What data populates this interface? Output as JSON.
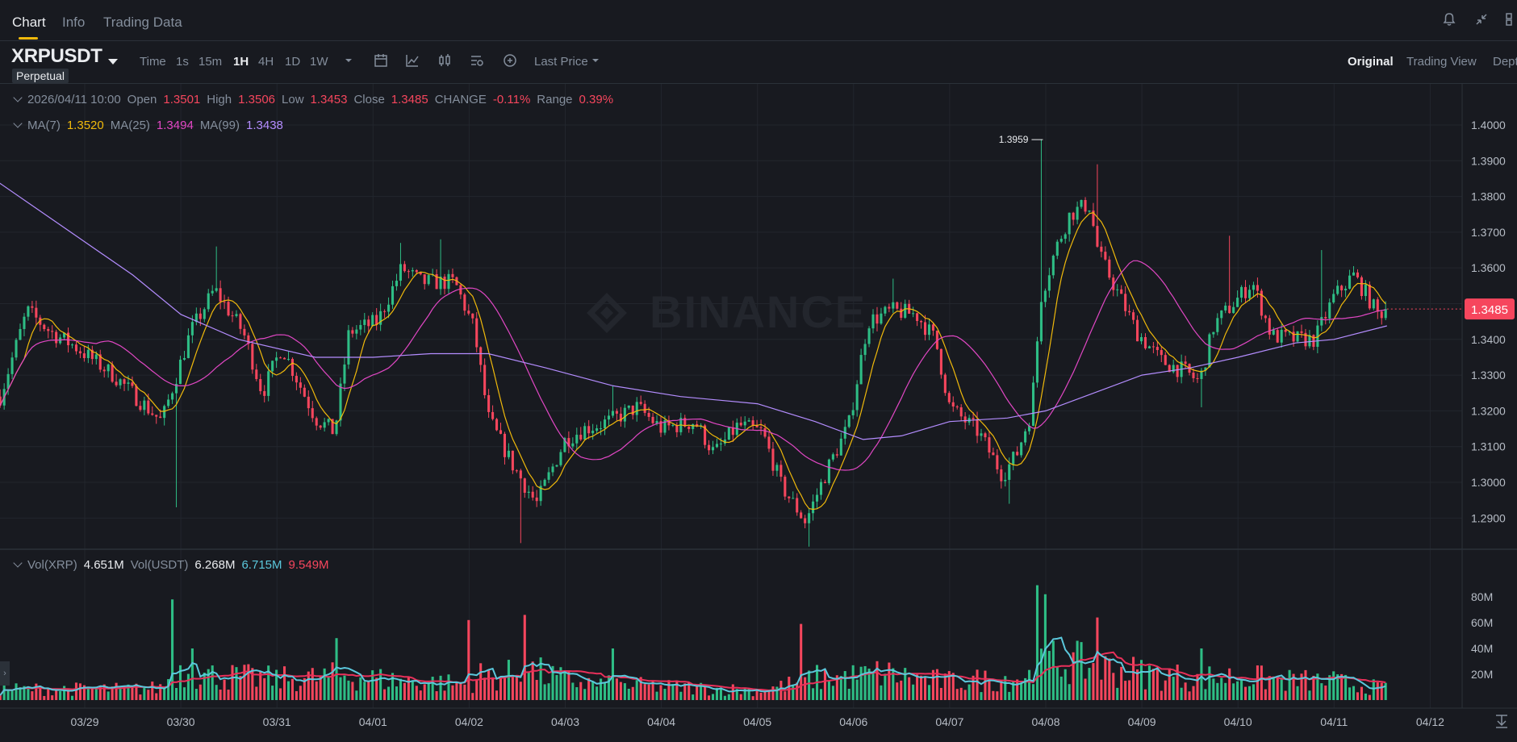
{
  "tabs": [
    {
      "label": "Chart",
      "active": true
    },
    {
      "label": "Info",
      "active": false
    },
    {
      "label": "Trading Data",
      "active": false
    }
  ],
  "top_icons": [
    "bell-icon",
    "collapse-icon",
    "layout-icon"
  ],
  "symbol": {
    "name": "XRPUSDT",
    "badge": "Perpetual"
  },
  "timeframes": [
    {
      "label": "Time",
      "active": false
    },
    {
      "label": "1s",
      "active": false
    },
    {
      "label": "15m",
      "active": false
    },
    {
      "label": "1H",
      "active": true
    },
    {
      "label": "4H",
      "active": false
    },
    {
      "label": "1D",
      "active": false
    },
    {
      "label": "1W",
      "active": false
    }
  ],
  "toolbar_icons": [
    "timeframe-dropdown-icon",
    "calendar-icon",
    "indicator-icon",
    "candle-type-icon",
    "settings-icon",
    "add-icon"
  ],
  "price_source": "Last Price",
  "views": [
    {
      "label": "Original",
      "active": true
    },
    {
      "label": "Trading View",
      "active": false
    },
    {
      "label": "Dept",
      "active": false
    }
  ],
  "ohlc": {
    "datetime": "2026/04/11 10:00",
    "open_label": "Open",
    "open": "1.3501",
    "high_label": "High",
    "high": "1.3506",
    "low_label": "Low",
    "low": "1.3453",
    "close_label": "Close",
    "close": "1.3485",
    "change_label": "CHANGE",
    "change": "-0.11%",
    "range_label": "Range",
    "range": "0.39%"
  },
  "ma": {
    "ma7_label": "MA(7)",
    "ma7": "1.3520",
    "ma25_label": "MA(25)",
    "ma25": "1.3494",
    "ma99_label": "MA(99)",
    "ma99": "1.3438"
  },
  "volume_legend": {
    "vol_xrp_label": "Vol(XRP)",
    "vol_xrp": "4.651M",
    "vol_usdt_label": "Vol(USDT)",
    "vol_usdt": "6.268M",
    "ma_fast": "6.715M",
    "ma_slow": "9.549M"
  },
  "watermark": "BINANCE",
  "colors": {
    "up": "#2ebd85",
    "down": "#f6465d",
    "ma7": "#f0b90b",
    "ma25": "#e147c4",
    "ma99": "#b48dff",
    "vol_ma_fast": "#5bc8dc",
    "vol_ma_slow": "#e8305a",
    "accent": "#f0b90b"
  },
  "chart_data": {
    "type": "candlestick",
    "interval": "1H",
    "ylim": [
      1.2815,
      1.4115
    ],
    "yticks": [
      "1.4000",
      "1.3900",
      "1.3800",
      "1.3700",
      "1.3600",
      "1.3500",
      "1.3400",
      "1.3300",
      "1.3200",
      "1.3100",
      "1.3000",
      "1.2900"
    ],
    "xticks": [
      "03/29",
      "03/30",
      "03/31",
      "04/01",
      "04/02",
      "04/03",
      "04/04",
      "04/05",
      "04/06",
      "04/07",
      "04/08",
      "04/09",
      "04/10",
      "04/11",
      "04/12"
    ],
    "last_price": "1.3485",
    "max_marker": {
      "value": "1.3959",
      "day_index": 9.97
    },
    "price_path": [
      [
        -0.88,
        1.324
      ],
      [
        -0.6,
        1.348
      ],
      [
        -0.35,
        1.342
      ],
      [
        -0.1,
        1.338
      ],
      [
        0.3,
        1.33
      ],
      [
        0.8,
        1.317
      ],
      [
        1.1,
        1.342
      ],
      [
        1.35,
        1.354
      ],
      [
        1.65,
        1.342
      ],
      [
        1.85,
        1.325
      ],
      [
        2.05,
        1.338
      ],
      [
        2.4,
        1.318
      ],
      [
        2.6,
        1.314
      ],
      [
        2.75,
        1.342
      ],
      [
        3.05,
        1.345
      ],
      [
        3.3,
        1.36
      ],
      [
        3.5,
        1.356
      ],
      [
        3.85,
        1.356
      ],
      [
        4.05,
        1.343
      ],
      [
        4.2,
        1.318
      ],
      [
        4.45,
        1.305
      ],
      [
        4.7,
        1.294
      ],
      [
        5.0,
        1.312
      ],
      [
        5.2,
        1.315
      ],
      [
        5.45,
        1.317
      ],
      [
        5.75,
        1.321
      ],
      [
        6.0,
        1.315
      ],
      [
        6.35,
        1.317
      ],
      [
        6.55,
        1.308
      ],
      [
        6.8,
        1.316
      ],
      [
        7.05,
        1.314
      ],
      [
        7.25,
        1.299
      ],
      [
        7.5,
        1.289
      ],
      [
        7.75,
        1.305
      ],
      [
        7.95,
        1.316
      ],
      [
        8.15,
        1.345
      ],
      [
        8.4,
        1.348
      ],
      [
        8.65,
        1.347
      ],
      [
        8.85,
        1.34
      ],
      [
        9.0,
        1.321
      ],
      [
        9.3,
        1.314
      ],
      [
        9.55,
        1.302
      ],
      [
        9.7,
        1.308
      ],
      [
        9.85,
        1.32
      ],
      [
        9.95,
        1.352
      ],
      [
        10.1,
        1.365
      ],
      [
        10.25,
        1.375
      ],
      [
        10.45,
        1.378
      ],
      [
        10.55,
        1.364
      ],
      [
        10.75,
        1.353
      ],
      [
        10.95,
        1.342
      ],
      [
        11.2,
        1.334
      ],
      [
        11.45,
        1.331
      ],
      [
        11.6,
        1.328
      ],
      [
        11.75,
        1.344
      ],
      [
        11.95,
        1.35
      ],
      [
        12.15,
        1.356
      ],
      [
        12.35,
        1.341
      ],
      [
        12.6,
        1.34
      ],
      [
        12.8,
        1.34
      ],
      [
        13.0,
        1.352
      ],
      [
        13.2,
        1.358
      ],
      [
        13.35,
        1.352
      ],
      [
        13.45,
        1.347
      ],
      [
        13.55,
        1.3485
      ]
    ],
    "price_spikes": [
      {
        "day": 0.95,
        "low": 1.293
      },
      {
        "day": 1.35,
        "high": 1.366
      },
      {
        "day": 3.3,
        "high": 1.367
      },
      {
        "day": 3.72,
        "high": 1.368
      },
      {
        "day": 4.55,
        "low": 1.283
      },
      {
        "day": 5.5,
        "high": 1.327
      },
      {
        "day": 7.55,
        "low": 1.282
      },
      {
        "day": 8.4,
        "high": 1.357
      },
      {
        "day": 9.6,
        "low": 1.294
      },
      {
        "day": 9.97,
        "high": 1.3959
      },
      {
        "day": 10.55,
        "high": 1.389
      },
      {
        "day": 10.6,
        "low": 1.362
      },
      {
        "day": 11.6,
        "low": 1.321
      },
      {
        "day": 11.92,
        "high": 1.369
      },
      {
        "day": 12.85,
        "high": 1.365
      }
    ],
    "ma99_path": [
      [
        -0.9,
        1.384
      ],
      [
        -0.2,
        1.371
      ],
      [
        0.5,
        1.358
      ],
      [
        1.0,
        1.347
      ],
      [
        1.6,
        1.34
      ],
      [
        2.4,
        1.335
      ],
      [
        3.0,
        1.335
      ],
      [
        3.6,
        1.336
      ],
      [
        4.2,
        1.336
      ],
      [
        4.8,
        1.332
      ],
      [
        5.5,
        1.327
      ],
      [
        6.2,
        1.324
      ],
      [
        7.0,
        1.322
      ],
      [
        7.6,
        1.317
      ],
      [
        8.1,
        1.312
      ],
      [
        8.5,
        1.313
      ],
      [
        9.0,
        1.317
      ],
      [
        9.6,
        1.318
      ],
      [
        10.0,
        1.32
      ],
      [
        10.5,
        1.325
      ],
      [
        11.0,
        1.33
      ],
      [
        11.5,
        1.332
      ],
      [
        12.0,
        1.335
      ],
      [
        12.6,
        1.339
      ],
      [
        13.0,
        1.34
      ],
      [
        13.55,
        1.3438
      ]
    ],
    "volume": {
      "ylim": [
        0,
        100
      ],
      "unit": "M",
      "yticks": [
        "80M",
        "60M",
        "40M",
        "20M"
      ],
      "profile": [
        [
          -0.9,
          9
        ],
        [
          0.5,
          9
        ],
        [
          0.8,
          10
        ],
        [
          0.95,
          24
        ],
        [
          1.3,
          20
        ],
        [
          2.0,
          17
        ],
        [
          2.4,
          18
        ],
        [
          2.7,
          20
        ],
        [
          3.2,
          16
        ],
        [
          4.0,
          13
        ],
        [
          4.1,
          20
        ],
        [
          4.3,
          18
        ],
        [
          4.6,
          25
        ],
        [
          4.9,
          18
        ],
        [
          5.3,
          13
        ],
        [
          6.0,
          11
        ],
        [
          7.0,
          8
        ],
        [
          7.3,
          12
        ],
        [
          7.6,
          18
        ],
        [
          8.0,
          19
        ],
        [
          8.3,
          22
        ],
        [
          8.6,
          18
        ],
        [
          9.0,
          15
        ],
        [
          9.5,
          17
        ],
        [
          9.9,
          20
        ],
        [
          10.0,
          32
        ],
        [
          10.3,
          30
        ],
        [
          10.7,
          25
        ],
        [
          11.0,
          22
        ],
        [
          11.5,
          18
        ],
        [
          12.0,
          19
        ],
        [
          12.5,
          16
        ],
        [
          13.0,
          15
        ],
        [
          13.55,
          9
        ]
      ],
      "spikes": [
        {
          "day": 0.93,
          "value": 78
        },
        {
          "day": 1.1,
          "value": 40
        },
        {
          "day": 2.6,
          "value": 48
        },
        {
          "day": 4.0,
          "value": 62
        },
        {
          "day": 4.58,
          "value": 66
        },
        {
          "day": 5.5,
          "value": 40
        },
        {
          "day": 7.45,
          "value": 59
        },
        {
          "day": 9.93,
          "value": 89
        },
        {
          "day": 9.99,
          "value": 82
        },
        {
          "day": 10.55,
          "value": 64
        },
        {
          "day": 11.6,
          "value": 40
        }
      ]
    }
  }
}
